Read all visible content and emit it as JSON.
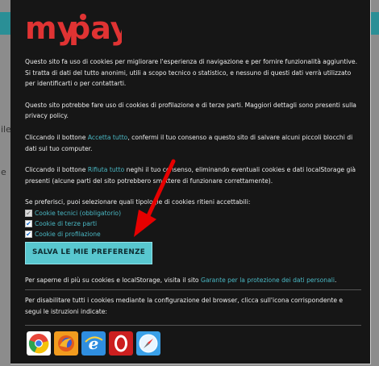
{
  "background": {
    "left_fragments": [
      "ile",
      "e"
    ]
  },
  "brand": {
    "logo_text": "myPay",
    "logo_my": "my",
    "logo_pay": "pay",
    "logo_color": "#e03333"
  },
  "intro": {
    "p1": "Questo sito fa uso di cookies per migliorare l'esperienza di navigazione e per fornire funzionalità aggiuntive. Si tratta di dati del tutto anonimi, utili a scopo tecnico o statistico, e nessuno di questi dati verrà utilizzato per identificarti o per contattarti.",
    "p2": "Questo sito potrebbe fare uso di cookies di profilazione e di terze parti. Maggiori dettagli sono presenti sulla privacy policy.",
    "p3_before": "Cliccando il bottone ",
    "p3_link": "Accetta tutto",
    "p3_after": ", confermi il tuo consenso a questo sito di salvare alcuni piccoli blocchi di dati sul tuo computer.",
    "p4_before": "Cliccando il bottone ",
    "p4_link": "Rifiuta tutto",
    "p4_after": " neghi il tuo consenso, eliminando eventuali cookies e dati localStorage già presenti (alcune parti del sito potrebbero smettere di funzionare correttamente).",
    "p5": "Se preferisci, puoi selezionare quali tipologie di cookies ritieni accettabili:"
  },
  "checkboxes": [
    {
      "label": "Cookie tecnici (obbligatorio)",
      "checked": true,
      "disabled": true
    },
    {
      "label": "Cookie di terze parti",
      "checked": true,
      "disabled": false
    },
    {
      "label": "Cookie di profilazione",
      "checked": true,
      "disabled": false
    }
  ],
  "save_button": "SALVA LE MIE PREFERENZE",
  "more_info": {
    "before": "Per saperne di più su cookies e localStorage, visita il sito ",
    "link": "Garante per la protezione dei dati personali",
    "after": "."
  },
  "disable_info": "Per disabilitare tutti i cookies mediante la configurazione del browser, clicca sull'icona corrispondente e segui le istruzioni indicate:",
  "browsers": [
    {
      "name": "chrome-icon"
    },
    {
      "name": "firefox-icon"
    },
    {
      "name": "edge-icon"
    },
    {
      "name": "opera-icon"
    },
    {
      "name": "safari-icon"
    }
  ],
  "colors": {
    "accent": "#4ab8c4",
    "button_bg": "#58c7cf",
    "modal_bg": "#161616",
    "arrow": "#e60000"
  }
}
